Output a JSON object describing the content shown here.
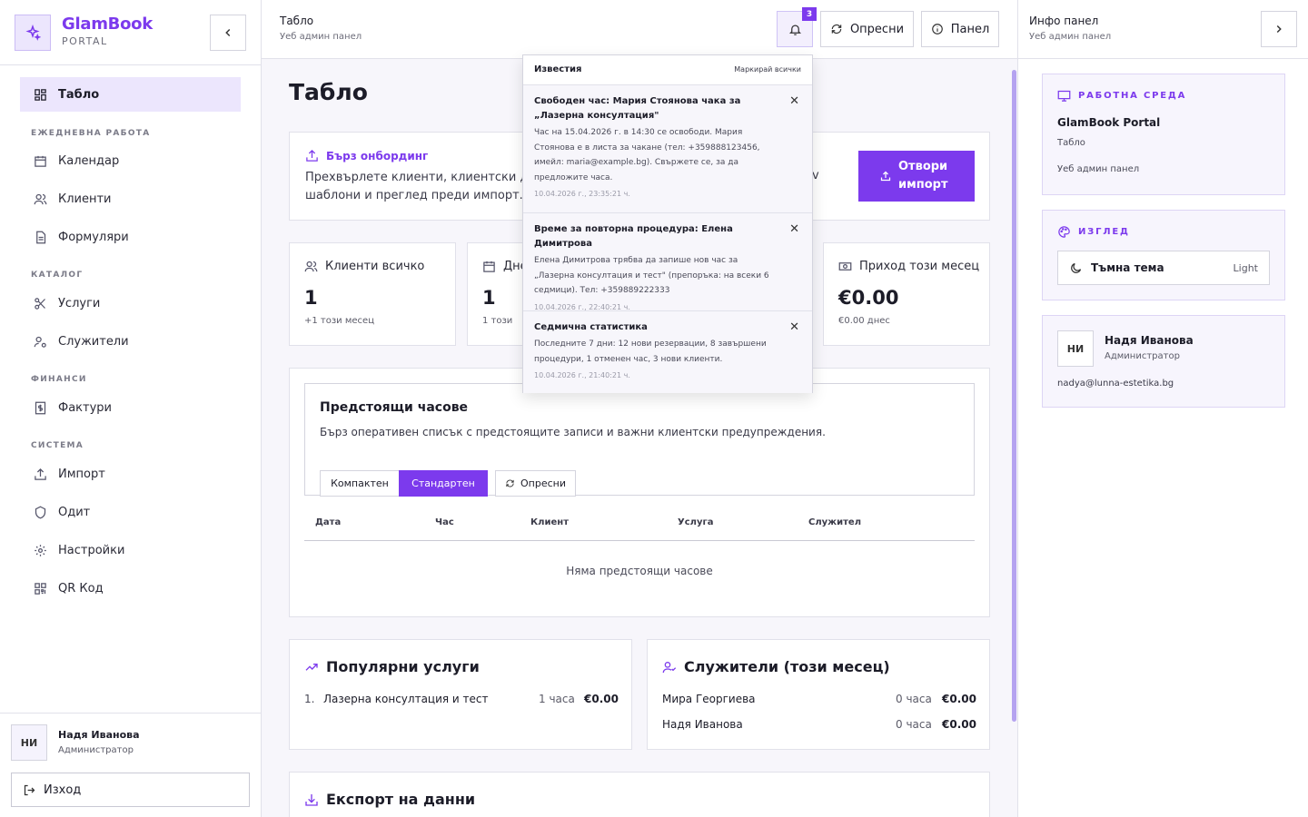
{
  "brand": {
    "name": "GlamBook",
    "sub": "PORTAL"
  },
  "nav": {
    "active": "Табло",
    "sections": [
      "ЕЖЕДНЕВНА РАБОТА",
      "КАТАЛОГ",
      "ФИНАНСИ",
      "СИСТЕМА"
    ],
    "items": [
      "Календар",
      "Клиенти",
      "Формуляри",
      "Услуги",
      "Служители",
      "Фактури",
      "Импорт",
      "Одит",
      "Настройки",
      "QR Код"
    ]
  },
  "user": {
    "initials": "НИ",
    "name": "Надя Иванова",
    "role": "Администратор",
    "email": "nadya@lunna-estetika.bg"
  },
  "logout": "Изход",
  "topbar": {
    "title": "Табло",
    "sub": "Уеб админ панел",
    "badge": "3",
    "refresh": "Опресни",
    "panel": "Панел"
  },
  "page": {
    "title": "Табло",
    "onboarding": {
      "title": "Бърз онбординг",
      "text": "Прехвърлете клиенти, клиентски до",
      "text_tail": "v",
      "text2": "шаблони и преглед преди импорт.",
      "button": "Отвори импорт"
    },
    "stats": [
      {
        "label": "Клиенти всичко",
        "value": "1",
        "sub": "+1 този месец"
      },
      {
        "label": "Дне",
        "value": "1",
        "sub": "1 този"
      },
      {
        "label": "Приход този месец",
        "value": "€0.00",
        "sub": "€0.00 днес"
      }
    ],
    "upcoming": {
      "title": "Предстоящи часове",
      "desc": "Бърз оперативен списък с предстоящите записи и важни клиентски предупреждения.",
      "compact": "Компактен",
      "standard": "Стандартен",
      "refresh": "Опресни",
      "columns": [
        "Дата",
        "Час",
        "Клиент",
        "Услуга",
        "Служител"
      ],
      "empty": "Няма предстоящи часове"
    },
    "popular": {
      "title": "Популярни услуги",
      "rows": [
        {
          "n": "1.",
          "name": "Лазерна консултация и тест",
          "count": "1 часа",
          "amount": "€0.00"
        }
      ]
    },
    "staff": {
      "title": "Служители (този месец)",
      "rows": [
        {
          "name": "Мира Георгиева",
          "hours": "0 часа",
          "amount": "€0.00"
        },
        {
          "name": "Надя Иванова",
          "hours": "0 часа",
          "amount": "€0.00"
        }
      ]
    },
    "export": {
      "title": "Експорт на данни"
    }
  },
  "notifications": {
    "title": "Известия",
    "mark_all": "Маркирай всички",
    "items": [
      {
        "title": "Свободен час: Мария Стоянова чака за „Лазерна консултация\"",
        "body": "Час на 15.04.2026 г. в 14:30 се освободи. Мария Стоянова е в листа за чакане (тел: +359888123456, имейл: maria@example.bg). Свържете се, за да предложите часа.",
        "time": "10.04.2026 г., 23:35:21 ч."
      },
      {
        "title": "Време за повторна процедура: Елена Димитрова",
        "body": "Елена Димитрова трябва да запише нов час за „Лазерна консултация и тест\" (препоръка: на всеки 6 седмици). Тел: +359889222333",
        "time": "10.04.2026 г., 22:40:21 ч."
      },
      {
        "title": "Седмична статистика",
        "body": "Последните 7 дни: 12 нови резервации, 8 завършени процедури, 1 отменен час, 3 нови клиенти.",
        "time": "10.04.2026 г., 21:40:21 ч."
      }
    ]
  },
  "right_panel": {
    "title": "Инфо панел",
    "sub": "Уеб админ панел",
    "workspace": {
      "label": "РАБОТНА СРЕДА",
      "app": "GlamBook Portal",
      "page": "Табло",
      "type": "Уеб админ панел"
    },
    "look": {
      "label": "ИЗГЛЕД",
      "theme": "Тъмна тема",
      "value": "Light"
    }
  },
  "colors": {
    "accent": "#7c3aed",
    "accent_light": "#ece6fd"
  }
}
